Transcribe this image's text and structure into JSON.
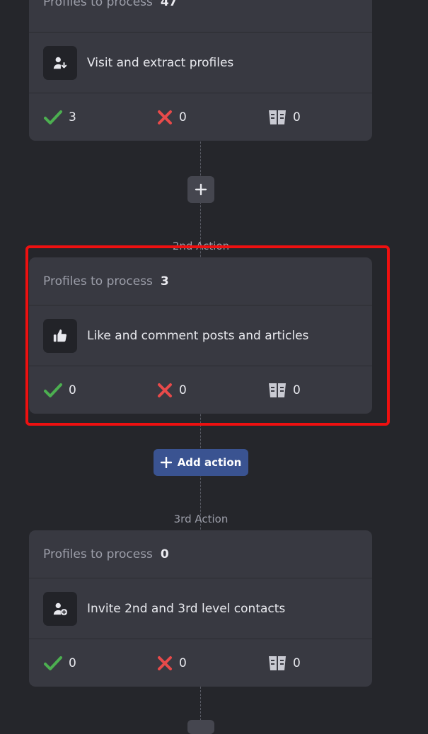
{
  "cards": [
    {
      "profiles_label": "Profiles to process",
      "profiles_count": "47",
      "action_title": "Visit and extract profiles",
      "action_icon": "person-download-icon",
      "stats": {
        "success": "3",
        "failed": "0",
        "skipped": "0"
      }
    },
    {
      "step_label": "2nd Action",
      "profiles_label": "Profiles to process",
      "profiles_count": "3",
      "action_title": "Like and comment posts and articles",
      "action_icon": "thumbs-up-icon",
      "stats": {
        "success": "0",
        "failed": "0",
        "skipped": "0"
      }
    },
    {
      "step_label": "3rd Action",
      "profiles_label": "Profiles to process",
      "profiles_count": "0",
      "action_title": "Invite 2nd and 3rd level contacts",
      "action_icon": "person-add-icon",
      "stats": {
        "success": "0",
        "failed": "0",
        "skipped": "0"
      }
    }
  ],
  "add_action_label": "Add action",
  "colors": {
    "background": "#25262b",
    "card": "#383941",
    "success": "#4caf50",
    "failed": "#e84a4a",
    "accent": "#3a5391",
    "highlight": "#ee1010"
  }
}
